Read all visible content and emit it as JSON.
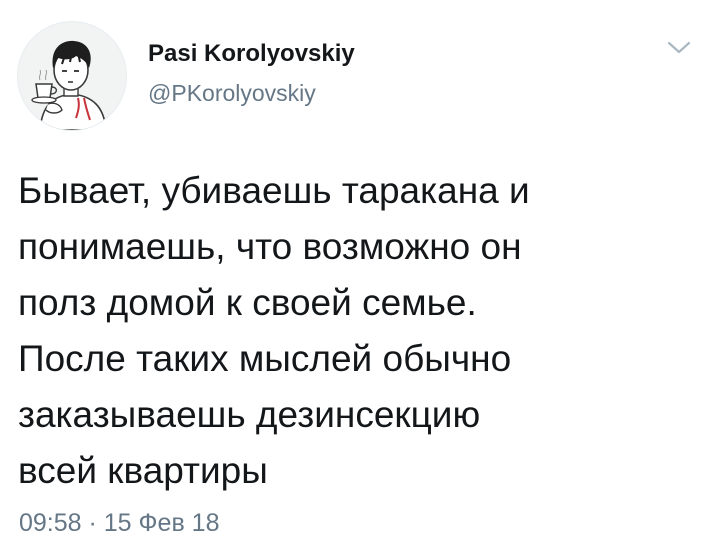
{
  "author": {
    "display_name": "Pasi Korolyovskiy",
    "handle": "@PKorolyovskiy",
    "avatar_icon": "avatar-drawing-person-drinking-tea"
  },
  "tweet": {
    "text": "Бывает, убиваешь таракана и\nпонимаешь, что возможно он\nполз домой к своей семье.\nПосле таких мыслей обычно\nзаказываешь дезинсекцию\nвсей квартиры",
    "timestamp": "09:58 · 15 Фев 18"
  },
  "menu": {
    "icon": "chevron-down-icon"
  },
  "colors": {
    "text": "#14171a",
    "secondary": "#657786",
    "caret": "#aab8c2",
    "background": "#ffffff"
  }
}
